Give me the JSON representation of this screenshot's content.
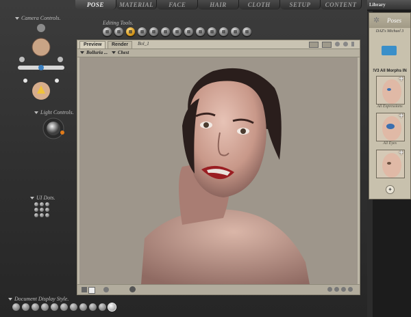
{
  "tabs": [
    "POSE",
    "MATERIAL",
    "FACE",
    "HAIR",
    "CLOTH",
    "SETUP",
    "CONTENT"
  ],
  "active_tab": "POSE",
  "camera_controls_label": "Camera Controls.",
  "editing_tools_label": "Editing Tools.",
  "light_controls_label": "Light Controls.",
  "ui_dots_label": "UI Dots.",
  "document_display_label": "Document Display Style.",
  "preview": {
    "tab_preview": "Preview",
    "tab_render": "Render",
    "doc_label": "Bol_1",
    "figure_menu": "Bolluria ...",
    "part_menu": "Chest"
  },
  "library": {
    "header": "Library",
    "category": "Poses",
    "subtitle": "DAZ's Michael 3",
    "folder_title": "!V3 All Morphs IN",
    "items": [
      {
        "caption": "All Expressions"
      },
      {
        "caption": "All Eyes"
      },
      {
        "caption": ""
      }
    ]
  },
  "colors": {
    "accent_tool": "#d79a1f",
    "lib_folder": "#3a8fc9",
    "lips": "#9a1e22"
  }
}
